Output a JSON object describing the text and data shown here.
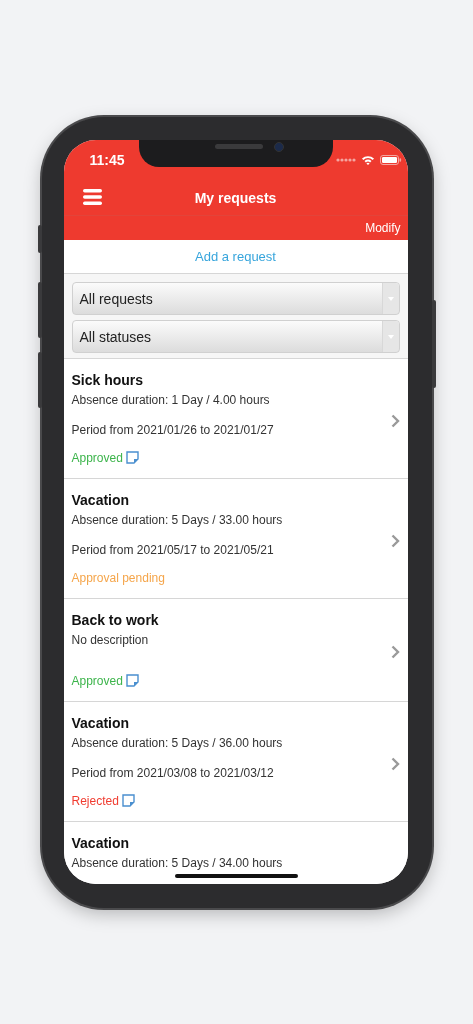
{
  "status_bar": {
    "time": "11:45"
  },
  "header": {
    "title": "My requests",
    "action": "Modify"
  },
  "add_link": "Add a request",
  "filters": [
    {
      "value": "All requests"
    },
    {
      "value": "All statuses"
    }
  ],
  "requests": [
    {
      "title": "Sick hours",
      "lines": [
        "Absence duration: 1 Day / 4.00 hours",
        "Period from 2021/01/26 to 2021/01/27"
      ],
      "status": "Approved",
      "color": "#3cb44b",
      "note": true
    },
    {
      "title": "Vacation",
      "lines": [
        "Absence duration: 5 Days / 33.00 hours",
        "Period from 2021/05/17 to 2021/05/21"
      ],
      "status": "Approval pending",
      "color": "#f5a54a",
      "note": false
    },
    {
      "title": "Back to work",
      "lines": [
        "No description"
      ],
      "status": "Approved",
      "color": "#3cb44b",
      "note": true
    },
    {
      "title": "Vacation",
      "lines": [
        "Absence duration: 5 Days / 36.00 hours",
        "Period from 2021/03/08 to 2021/03/12"
      ],
      "status": "Rejected",
      "color": "#f03c30",
      "note": true
    },
    {
      "title": "Vacation",
      "lines": [
        "Absence duration: 5 Days / 34.00 hours"
      ]
    }
  ]
}
